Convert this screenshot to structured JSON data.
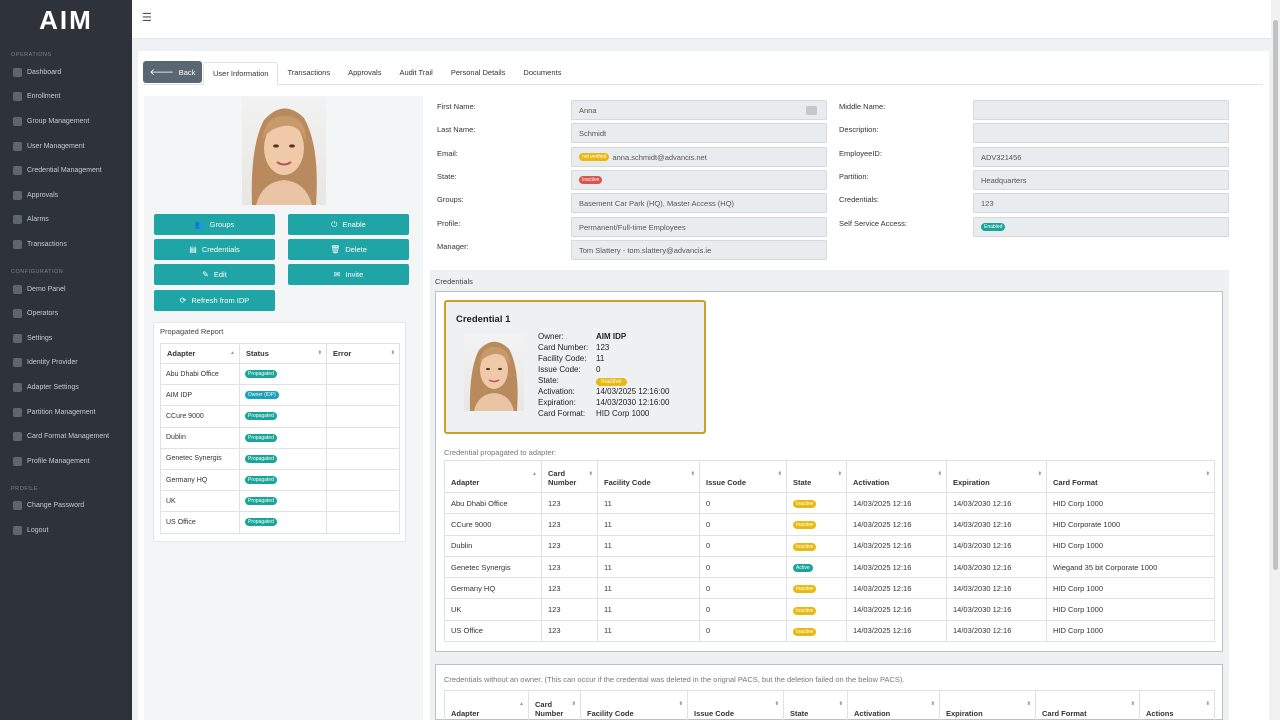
{
  "app": {
    "logo": "AIM"
  },
  "sidebar": {
    "sections": [
      {
        "label": "OPERATIONS",
        "items": [
          "Dashboard",
          "Enrollment",
          "Group Management",
          "User Management",
          "Credential Management",
          "Approvals",
          "Alarms",
          "Transactions"
        ]
      },
      {
        "label": "CONFIGURATION",
        "items": [
          "Demo Panel",
          "Operators",
          "Settings",
          "Identity Provider",
          "Adapter Settings",
          "Partition Management",
          "Card Format Management",
          "Profile Management"
        ]
      },
      {
        "label": "PROFILE",
        "items": [
          "Change Password",
          "Logout"
        ]
      }
    ]
  },
  "tabs": {
    "back_label": "Back",
    "items": [
      "User Information",
      "Transactions",
      "Approvals",
      "Audit Trail",
      "Personal Details",
      "Documents"
    ]
  },
  "actions": {
    "groups": "Groups",
    "enable": "Enable",
    "credentials": "Credentials",
    "delete": "Delete",
    "edit": "Edit",
    "invite": "Invite",
    "refresh": "Refresh from IDP"
  },
  "propagated": {
    "title": "Propagated Report",
    "columns": [
      "Adapter",
      "Status",
      "Error"
    ],
    "rows": [
      {
        "adapter": "Abu Dhabi Office",
        "status": "Propagated"
      },
      {
        "adapter": "AIM IDP",
        "status": "Owner (IDP)"
      },
      {
        "adapter": "CCure 9000",
        "status": "Propagated"
      },
      {
        "adapter": "Dublin",
        "status": "Propagated"
      },
      {
        "adapter": "Genetec Synergis",
        "status": "Propagated"
      },
      {
        "adapter": "Germany HQ",
        "status": "Propagated"
      },
      {
        "adapter": "UK",
        "status": "Propagated"
      },
      {
        "adapter": "US Office",
        "status": "Propagated"
      }
    ]
  },
  "user": {
    "first_name_label": "First Name:",
    "first_name": "Anna",
    "last_name_label": "Last Name:",
    "last_name": "Schmidt",
    "email_label": "Email:",
    "email_badge": "not verified",
    "email": "anna.schmidt@advancis.net",
    "state_label": "State:",
    "state": "Inactive",
    "groups_label": "Groups:",
    "groups": "Basement Car Park (HQ), Master Access (HQ)",
    "profile_label": "Profile:",
    "profile": "Permanent/Full-time Employees",
    "manager_label": "Manager:",
    "manager": "Tom Slattery - tom.slattery@advancis.ie",
    "middle_name_label": "Middle Name:",
    "middle_name": "",
    "description_label": "Description:",
    "description": "",
    "employee_id_label": "EmployeeID:",
    "employee_id": "ADV321456",
    "partition_label": "Partition:",
    "partition": "Headquarters",
    "credentials_label": "Credentials:",
    "credentials": "123",
    "self_service_label": "Self Service Access:",
    "self_service": "Enabled"
  },
  "credentials": {
    "section_title": "Credentials",
    "card": {
      "title": "Credential 1",
      "owner_label": "Owner:",
      "owner": "AIM IDP",
      "card_number_label": "Card Number:",
      "card_number": "123",
      "facility_code_label": "Facility Code:",
      "facility_code": "11",
      "issue_code_label": "Issue Code:",
      "issue_code": "0",
      "state_label": "State:",
      "state": "Inactive",
      "activation_label": "Activation:",
      "activation": "14/03/2025 12:16:00",
      "expiration_label": "Expiration:",
      "expiration": "14/03/2030 12:16:00",
      "card_format_label": "Card Format:",
      "card_format": "HID Corp 1000"
    },
    "propagated_label": "Credential propagated to adapter:",
    "columns": [
      "Adapter",
      "Card Number",
      "Facility Code",
      "Issue Code",
      "State",
      "Activation",
      "Expiration",
      "Card Format"
    ],
    "rows": [
      {
        "adapter": "Abu Dhabi Office",
        "card": "123",
        "facility": "11",
        "issue": "0",
        "state": "Inactive",
        "activation": "14/03/2025 12:16",
        "expiration": "14/03/2030 12:16",
        "format": "HID Corp 1000"
      },
      {
        "adapter": "CCure 9000",
        "card": "123",
        "facility": "11",
        "issue": "0",
        "state": "Inactive",
        "activation": "14/03/2025 12:16",
        "expiration": "14/03/2030 12:16",
        "format": "HID Corporate 1000"
      },
      {
        "adapter": "Dublin",
        "card": "123",
        "facility": "11",
        "issue": "0",
        "state": "Inactive",
        "activation": "14/03/2025 12:16",
        "expiration": "14/03/2030 12:16",
        "format": "HID Corp 1000"
      },
      {
        "adapter": "Genetec Synergis",
        "card": "123",
        "facility": "11",
        "issue": "0",
        "state": "Active",
        "activation": "14/03/2025 12:16",
        "expiration": "14/03/2030 12:16",
        "format": "Wiegand 35 bit Corporate 1000"
      },
      {
        "adapter": "Germany HQ",
        "card": "123",
        "facility": "11",
        "issue": "0",
        "state": "Inactive",
        "activation": "14/03/2025 12:16",
        "expiration": "14/03/2030 12:16",
        "format": "HID Corp 1000"
      },
      {
        "adapter": "UK",
        "card": "123",
        "facility": "11",
        "issue": "0",
        "state": "Inactive",
        "activation": "14/03/2025 12:16",
        "expiration": "14/03/2030 12:16",
        "format": "HID Corp 1000"
      },
      {
        "adapter": "US Office",
        "card": "123",
        "facility": "11",
        "issue": "0",
        "state": "Inactive",
        "activation": "14/03/2025 12:16",
        "expiration": "14/03/2030 12:16",
        "format": "HID Corp 1000"
      }
    ]
  },
  "orphans": {
    "label": "Credentials without an owner. (This can occur if the credential was deleted in the orignal PACS, but the deletion failed on the below PACS).",
    "columns": [
      "Adapter",
      "Card Number",
      "Facility Code",
      "Issue Code",
      "State",
      "Activation",
      "Expiration",
      "Card Format",
      "Actions"
    ]
  },
  "colors": {
    "primary": "#1fa5a5",
    "sidebar": "#2d3338",
    "inactive": "#e8b913",
    "active": "#1aa59a",
    "state_inactive_red": "#d9534f",
    "card_border": "#c9a02a"
  }
}
